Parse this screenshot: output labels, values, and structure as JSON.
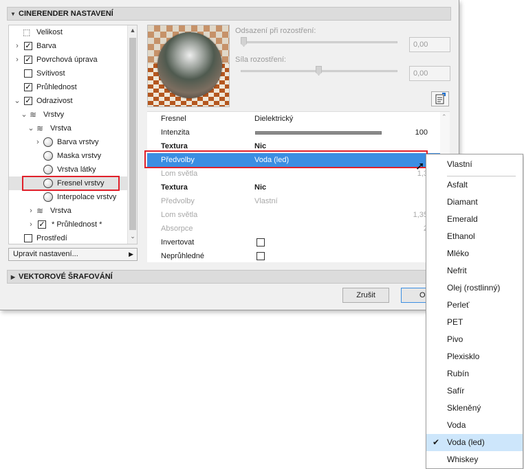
{
  "sections": {
    "cinerender": "CINERENDER NASTAVENÍ",
    "vector_hatching": "VEKTOROVÉ ŠRAFOVÁNÍ"
  },
  "tree": [
    {
      "label": "Velikost"
    },
    {
      "label": "Barva",
      "checked": true
    },
    {
      "label": "Povrchová úprava",
      "checked": true
    },
    {
      "label": "Svítivost",
      "checked": false
    },
    {
      "label": "Průhlednost",
      "checked": true
    },
    {
      "label": "Odrazivost",
      "checked": true
    },
    {
      "label": "Vrstvy"
    },
    {
      "label": "Vrstva"
    },
    {
      "label": "Barva vrstvy"
    },
    {
      "label": "Maska vrstvy"
    },
    {
      "label": "Vrstva látky"
    },
    {
      "label": "Fresnel vrstvy",
      "highlighted": true
    },
    {
      "label": "Interpolace vrstvy"
    },
    {
      "label": "Vrstva"
    },
    {
      "label": "* Průhlednost *",
      "checked": true
    },
    {
      "label": "Prostředí",
      "checked": false
    }
  ],
  "edit_settings": "Upravit nastavení...",
  "sliders": {
    "offset_label": "Odsazení při rozostření:",
    "offset_value": "0,00",
    "strength_label": "Síla rozostření:",
    "strength_value": "0,00"
  },
  "props": [
    {
      "key": "Fresnel",
      "value": "Dielektrický"
    },
    {
      "key": "Intenzita",
      "number": "100"
    },
    {
      "key": "Textura",
      "value": "Nic"
    },
    {
      "key": "Předvolby",
      "value": "Voda (led)"
    },
    {
      "key": "Lom světla",
      "number": "1,3"
    },
    {
      "key": "Textura",
      "value": "Nic"
    },
    {
      "key": "Předvolby",
      "value": "Vlastní"
    },
    {
      "key": "Lom světla",
      "number": "1,35"
    },
    {
      "key": "Absorpce",
      "number": "2"
    },
    {
      "key": "Invertovat"
    },
    {
      "key": "Neprůhledné"
    }
  ],
  "buttons": {
    "cancel": "Zrušit",
    "ok": "O"
  },
  "menu": {
    "items": [
      "Vlastní",
      "Asfalt",
      "Diamant",
      "Emerald",
      "Ethanol",
      "Mléko",
      "Nefrit",
      "Olej (rostlinný)",
      "Perleť",
      "PET",
      "Pivo",
      "Plexisklo",
      "Rubín",
      "Safír",
      "Skleněný",
      "Voda",
      "Voda (led)",
      "Whiskey"
    ],
    "checked": "Voda (led)"
  },
  "colors": {
    "selection": "#3b8ee2",
    "highlight_box": "#e0202a",
    "menu_checked_bg": "#cde6fb"
  }
}
